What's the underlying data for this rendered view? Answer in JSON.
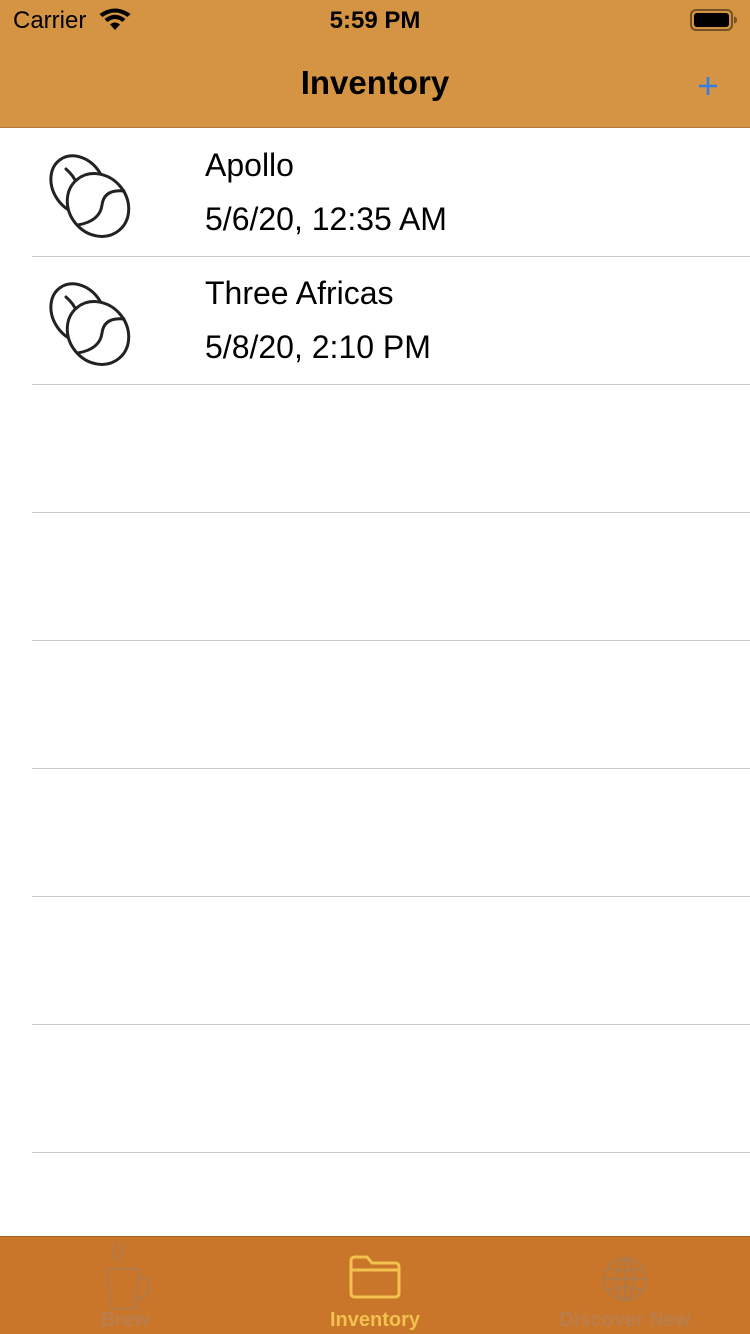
{
  "status_bar": {
    "carrier": "Carrier",
    "time": "5:59 PM",
    "wifi_icon": "wifi-icon",
    "battery_icon": "battery-icon"
  },
  "nav": {
    "title": "Inventory",
    "add_label": "+",
    "add_icon": "plus-icon"
  },
  "list": {
    "items": [
      {
        "title": "Apollo",
        "date": "5/6/20, 12:35 AM",
        "icon": "coffee-bean-icon"
      },
      {
        "title": "Three Africas",
        "date": "5/8/20, 2:10 PM",
        "icon": "coffee-bean-icon"
      }
    ]
  },
  "tabbar": {
    "tabs": [
      {
        "label": "Brew",
        "icon": "coffee-cup-icon",
        "active": false
      },
      {
        "label": "Inventory",
        "icon": "folder-icon",
        "active": true
      },
      {
        "label": "Discover New",
        "icon": "globe-icon",
        "active": false
      }
    ]
  },
  "colors": {
    "nav_background": "#D59444",
    "tabbar_background": "#C9752A",
    "active_tint": "#F2C14E",
    "add_button_tint": "#2F7FE5",
    "separator": "#C8C7CC"
  }
}
